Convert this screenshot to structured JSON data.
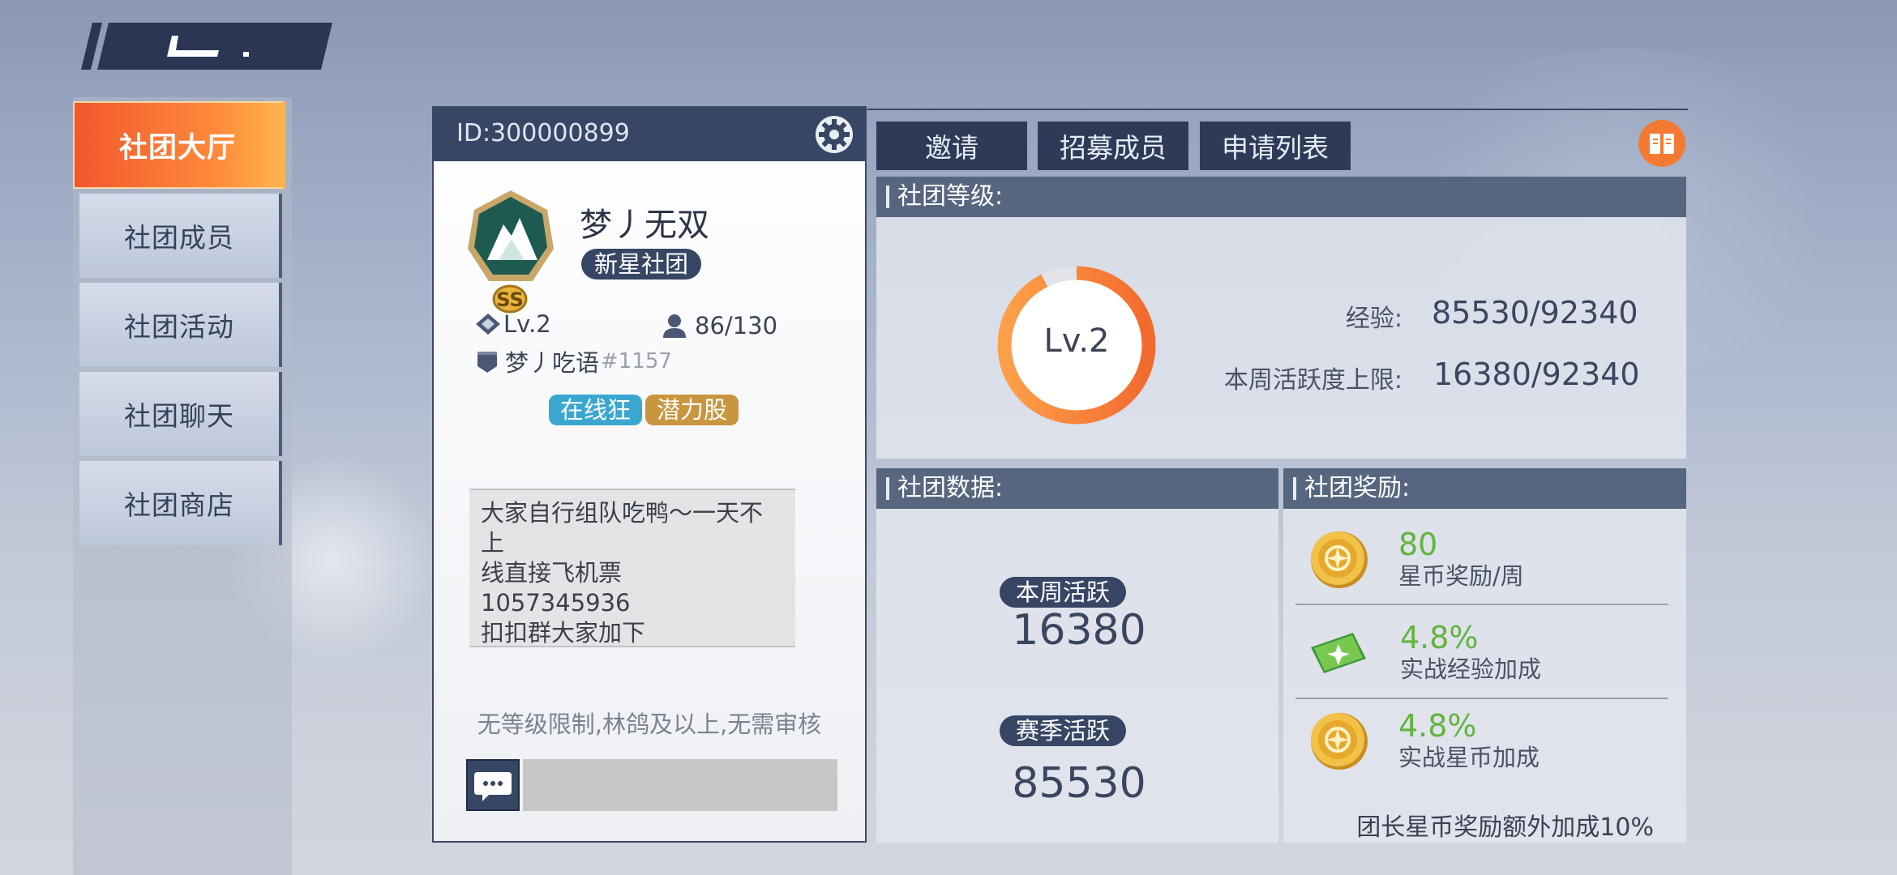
{
  "menu": {
    "items": [
      {
        "label": "社团大厅",
        "active": true
      },
      {
        "label": "社团成员",
        "active": false
      },
      {
        "label": "社团活动",
        "active": false
      },
      {
        "label": "社团聊天",
        "active": false
      },
      {
        "label": "社团商店",
        "active": false
      }
    ]
  },
  "card": {
    "id": "ID:300000899",
    "name": "梦丿无双",
    "type_tag": "新星社团",
    "rank_badge": "SS",
    "level": "Lv.2",
    "members": "86/130",
    "leader": "梦丿吃语",
    "leader_num": "#1157",
    "tags": [
      "在线狂",
      "潜力股"
    ],
    "notice": "大家自行组队吃鸭～一天不上\n线直接飞机票\n1057345936\n扣扣群大家加下",
    "requirement": "无等级限制,林鸽及以上,无需审核"
  },
  "tabs": {
    "invite": "邀请",
    "recruit": "招募成员",
    "apply_list": "申请列表"
  },
  "level_panel": {
    "title": "社团等级:",
    "ring_label": "Lv.2",
    "exp_label": "经验:",
    "exp_value": "85530/92340",
    "exp_fraction": 0.926,
    "weekly_label": "本周活跃度上限:",
    "weekly_value": "16380/92340"
  },
  "data_panel": {
    "title": "社团数据:",
    "weekly_label": "本周活跃",
    "weekly_value": "16380",
    "season_label": "赛季活跃",
    "season_value": "85530"
  },
  "reward_panel": {
    "title": "社团奖励:",
    "rewards": [
      {
        "value": "80",
        "desc": "星币奖励/周",
        "icon": "gold-coin-icon"
      },
      {
        "value": "4.8%",
        "desc": "实战经验加成",
        "icon": "green-ticket-icon"
      },
      {
        "value": "4.8%",
        "desc": "实战星币加成",
        "icon": "gold-coin-icon"
      }
    ],
    "footer": "团长星币奖励额外加成10%"
  },
  "colors": {
    "accent_orange": "#f2572c",
    "navy": "#364664",
    "green": "#61b53e"
  }
}
